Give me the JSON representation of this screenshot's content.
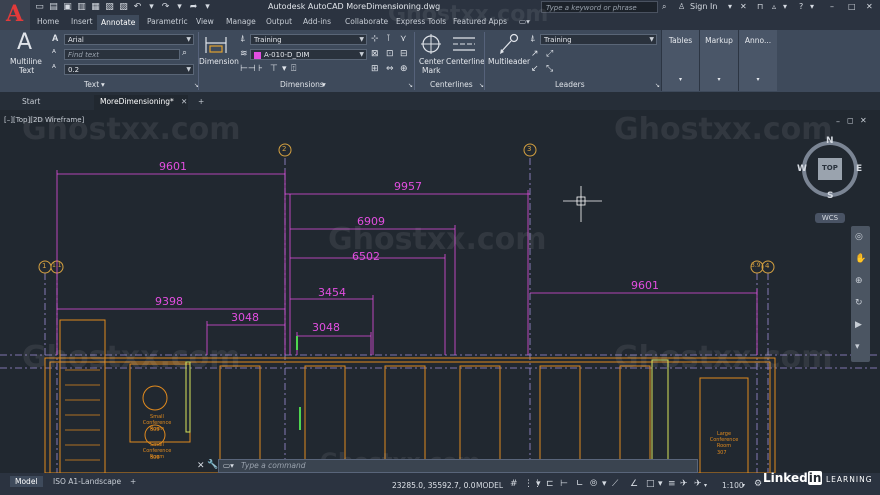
{
  "app": {
    "title": "Autodesk AutoCAD  MoreDimensioning.dwg",
    "search_placeholder": "Type a keyword or phrase",
    "sign_in": "Sign In",
    "logo_letter": "A"
  },
  "menu_tabs": [
    "Home",
    "Insert",
    "Annotate",
    "Parametric",
    "View",
    "Manage",
    "Output",
    "Add-ins",
    "Collaborate",
    "Express Tools",
    "Featured Apps"
  ],
  "ribbon": {
    "text_panel": {
      "button_label_line1": "Multiline",
      "button_label_line2": "Text",
      "font_value": "Arial",
      "find_placeholder": "Find text",
      "height_value": "0.2",
      "panel_label": "Text"
    },
    "dimensions_panel": {
      "button_label": "Dimension",
      "style_value": "Training",
      "layer_value": "A-010-D_DIM",
      "panel_label": "Dimensions"
    },
    "centerlines_panel": {
      "center_mark_line1": "Center",
      "center_mark_line2": "Mark",
      "centerline_label": "Centerline",
      "panel_label": "Centerlines"
    },
    "leaders_panel": {
      "button_label": "Multileader",
      "style_value": "Training",
      "panel_label": "Leaders"
    },
    "collapsed_panels": [
      "Tables",
      "Markup",
      "Anno..."
    ]
  },
  "file_tabs": [
    "Start",
    "MoreDimensioning*"
  ],
  "viewport": {
    "label": "[–][Top][2D Wireframe]",
    "watermark": "Ghostxx.com",
    "viewcube": {
      "top": "TOP",
      "n": "N",
      "s": "S",
      "e": "E",
      "w": "W"
    },
    "wcs": "WCS"
  },
  "drawing": {
    "grid_bubbles": [
      "2",
      "3",
      "1",
      "1.1",
      "3.9",
      "4"
    ],
    "dimensions": [
      "9601",
      "9957",
      "6909",
      "6502",
      "3454",
      "9398",
      "3048",
      "3048",
      "9601"
    ],
    "room_labels": [
      "Small Conference Room",
      "Small Conference Room",
      "Large Conference Room"
    ],
    "room_numbers": [
      "305",
      "306",
      "307"
    ]
  },
  "command_line": {
    "placeholder": "Type a command"
  },
  "status": {
    "layout_tabs": [
      "Model",
      "ISO A1-Landscape"
    ],
    "coordinates": "23285.0, 35592.7, 0.0",
    "model_label": "MODEL",
    "scale": "1:100"
  },
  "branding": {
    "linked": "Linked",
    "in": "in",
    "learning": "LEARNING"
  },
  "colors": {
    "background": "#212830",
    "ribbon": "#3e4a5b",
    "dimension": "#e24ee0",
    "walls": "#e08a1e",
    "gridline": "#9f8fd8",
    "highlight": "#d7e35a",
    "green": "#4fd64f"
  }
}
